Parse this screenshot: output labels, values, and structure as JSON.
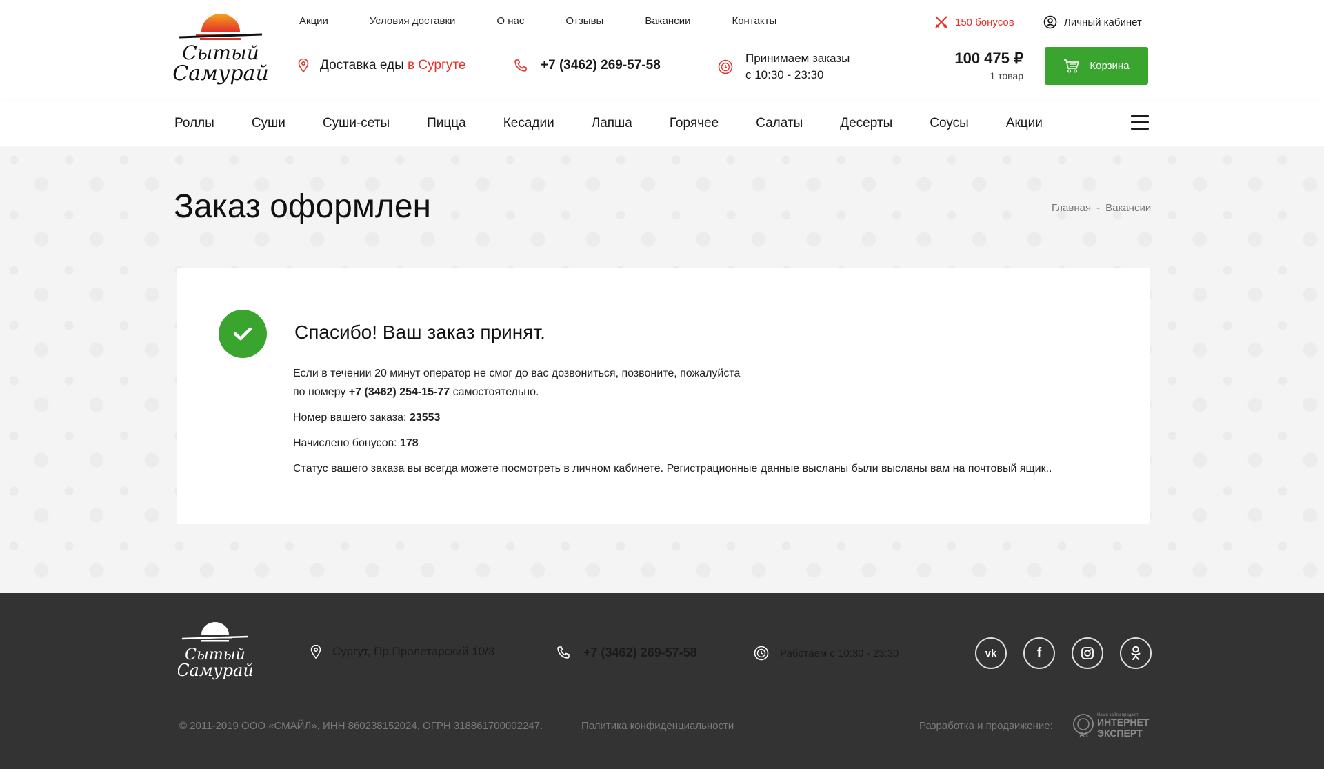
{
  "brand": {
    "logo_text": "Сытый Самурай"
  },
  "topnav": [
    "Акции",
    "Условия доставки",
    "О нас",
    "Отзывы",
    "Вакансии",
    "Контакты"
  ],
  "header": {
    "bonus": "150 бонусов",
    "account": "Личный кабинет",
    "delivery_prefix": "Доставка еды",
    "delivery_city": "в Сургуте",
    "phone": "+7 (3462) 269-57-58",
    "hours_line1": "Принимаем заказы",
    "hours_line2": "с 10:30 - 23:30",
    "cart_sum": "100 475 ₽",
    "cart_count": "1 товар",
    "cart_button": "Корзина"
  },
  "categories": [
    "Роллы",
    "Суши",
    "Суши-сеты",
    "Пицца",
    "Кесадии",
    "Лапша",
    "Горячее",
    "Салаты",
    "Десерты",
    "Соусы",
    "Акции"
  ],
  "page": {
    "title": "Заказ оформлен",
    "breadcrumb": [
      "Главная",
      "-",
      "Вакансии"
    ]
  },
  "order": {
    "thanks": "Спасибо! Ваш заказ принят.",
    "call_line1": "Если в течении 20 минут оператор не смог до вас дозвониться, позвоните, пожалуйста",
    "call_line2_prefix": "по номеру",
    "call_phone": "+7 (3462) 254-15-77",
    "call_line2_suffix": "самостоятельно.",
    "order_number_label": "Номер вашего заказа:",
    "order_number": "23553",
    "bonus_label": "Начислено бонусов:",
    "bonus_value": "178",
    "status_text": "Статус вашего заказа вы всегда можете посмотреть в личном кабинете. Регистрационные данные высланы были высланы вам на почтовый ящик.."
  },
  "footer": {
    "address": "Сургут, Пр.Пролетарский 10/3",
    "phone": "+7 (3462) 269-57-58",
    "hours": "Работаем с 10:30 - 23:30",
    "copyright": "© 2011-2019   ООО «СМАЙЛ», ИНН 860238152024, ОГРН 318861700002247.",
    "policy": "Политика конфиденциальности",
    "dev_label": "Разработка и продвижение:",
    "dev_logo_small": "Наши сайты продают",
    "dev_logo_line1": "ИНТЕРНЕТ",
    "dev_logo_line2": "ЭКСПЕРТ",
    "socials": [
      "vk",
      "facebook",
      "instagram",
      "odnoklassniki"
    ]
  },
  "colors": {
    "accent_red": "#e2332b",
    "accent_green": "#3aa52e",
    "footer_bg": "#333333"
  }
}
